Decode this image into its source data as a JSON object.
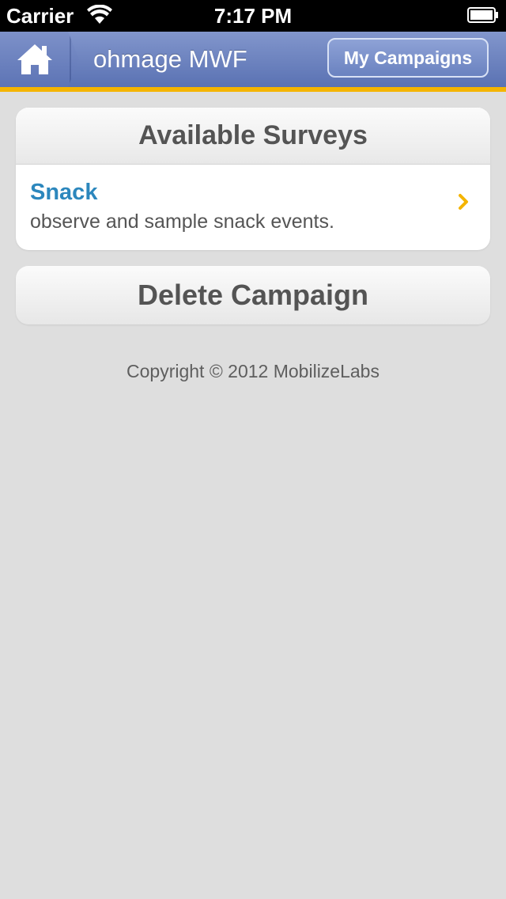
{
  "status_bar": {
    "carrier": "Carrier",
    "time": "7:17 PM",
    "icons": [
      "wifi-icon",
      "battery-icon"
    ]
  },
  "nav_bar": {
    "title": "ohmage MWF",
    "my_campaigns_label": "My Campaigns",
    "home_icon": "home-icon",
    "accent_color": "#f4b400",
    "bar_color": "#6b82c0"
  },
  "surveys": {
    "header": "Available Surveys",
    "items": [
      {
        "name": "Snack",
        "description": "observe and sample snack events.",
        "icon": "chevron-right-icon"
      }
    ]
  },
  "actions": {
    "delete_label": "Delete Campaign"
  },
  "footer": {
    "copyright": "Copyright © 2012 MobilizeLabs"
  },
  "colors": {
    "survey_name": "#2c87bd",
    "chevron": "#f4b400",
    "background": "#dedede"
  }
}
